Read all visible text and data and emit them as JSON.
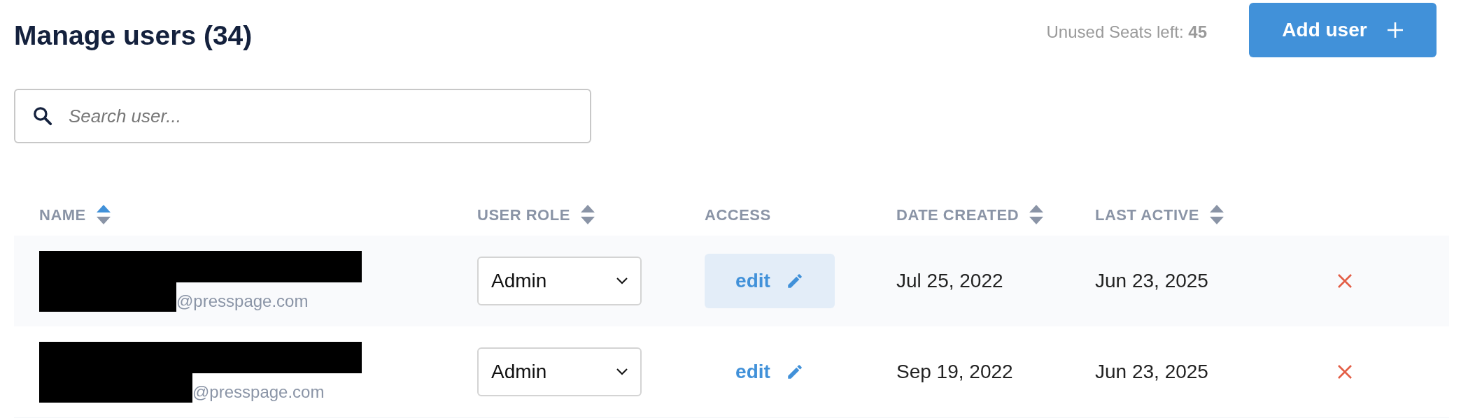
{
  "header": {
    "title": "Manage users (34)",
    "seats_label": "Unused Seats left: **45**",
    "add_button": "Add user"
  },
  "search": {
    "placeholder": "Search user..."
  },
  "table": {
    "columns": [
      {
        "label": "NAME",
        "sortable": true,
        "sorted": true
      },
      {
        "label": "USER ROLE",
        "sortable": true,
        "sorted": false
      },
      {
        "label": "ACCESS",
        "sortable": false
      },
      {
        "label": "DATE CREATED",
        "sortable": true,
        "sorted": false
      },
      {
        "label": "LAST ACTIVE",
        "sortable": true,
        "sorted": false
      }
    ],
    "rows": [
      {
        "email": "@presspage.com",
        "role": "Admin",
        "access": "edit",
        "access_highlighted": true,
        "date_created": "Jul 25, 2022",
        "last_active": "Jun 23, 2025"
      },
      {
        "email": "@presspage.com",
        "role": "Admin",
        "access": "edit",
        "access_highlighted": false,
        "date_created": "Sep 19, 2022",
        "last_active": "Jun 23, 2025"
      }
    ]
  }
}
